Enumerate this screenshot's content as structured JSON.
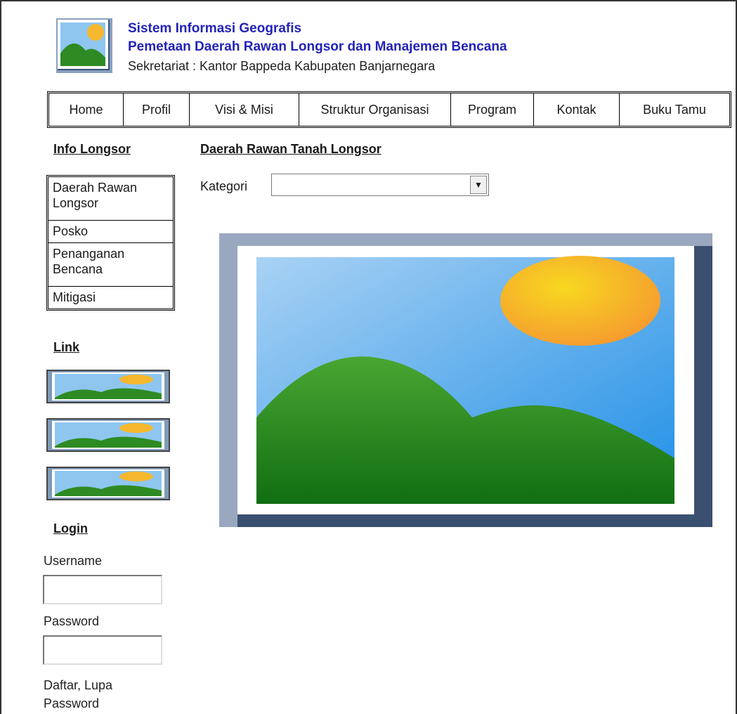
{
  "header": {
    "title_line1": "Sistem Informasi Geografis",
    "title_line2": "Pemetaan Daerah Rawan Longsor dan Manajemen Bencana",
    "subtitle": "Sekretariat : Kantor Bappeda Kabupaten Banjarnegara",
    "logo_icon": "landscape-image-icon"
  },
  "nav": {
    "items": [
      {
        "label": "Home"
      },
      {
        "label": "Profil"
      },
      {
        "label": "Visi & Misi"
      },
      {
        "label": "Struktur Organisasi"
      },
      {
        "label": "Program"
      },
      {
        "label": "Kontak"
      },
      {
        "label": "Buku Tamu"
      }
    ]
  },
  "sidebar": {
    "info_heading": "Info Longsor",
    "info_items": [
      {
        "label": "Daerah Rawan Longsor"
      },
      {
        "label": "Posko"
      },
      {
        "label": "Penanganan Bencana"
      },
      {
        "label": "Mitigasi"
      }
    ],
    "link_heading": "Link",
    "link_icon": "landscape-image-icon",
    "login": {
      "heading": "Login",
      "username_label": "Username",
      "password_label": "Password",
      "links": "Daftar, Lupa Password"
    }
  },
  "main": {
    "heading": "Daerah Rawan Tanah Longsor",
    "kategori_label": "Kategori",
    "kategori_value": "",
    "image_icon": "landscape-image-icon"
  },
  "colors": {
    "title": "#2323b8",
    "sky": "#8ec6f0",
    "sun": "#f5b82e",
    "hill": "#2e8b23",
    "frame_light": "#9aa8bf",
    "frame_dark": "#3b5070"
  }
}
